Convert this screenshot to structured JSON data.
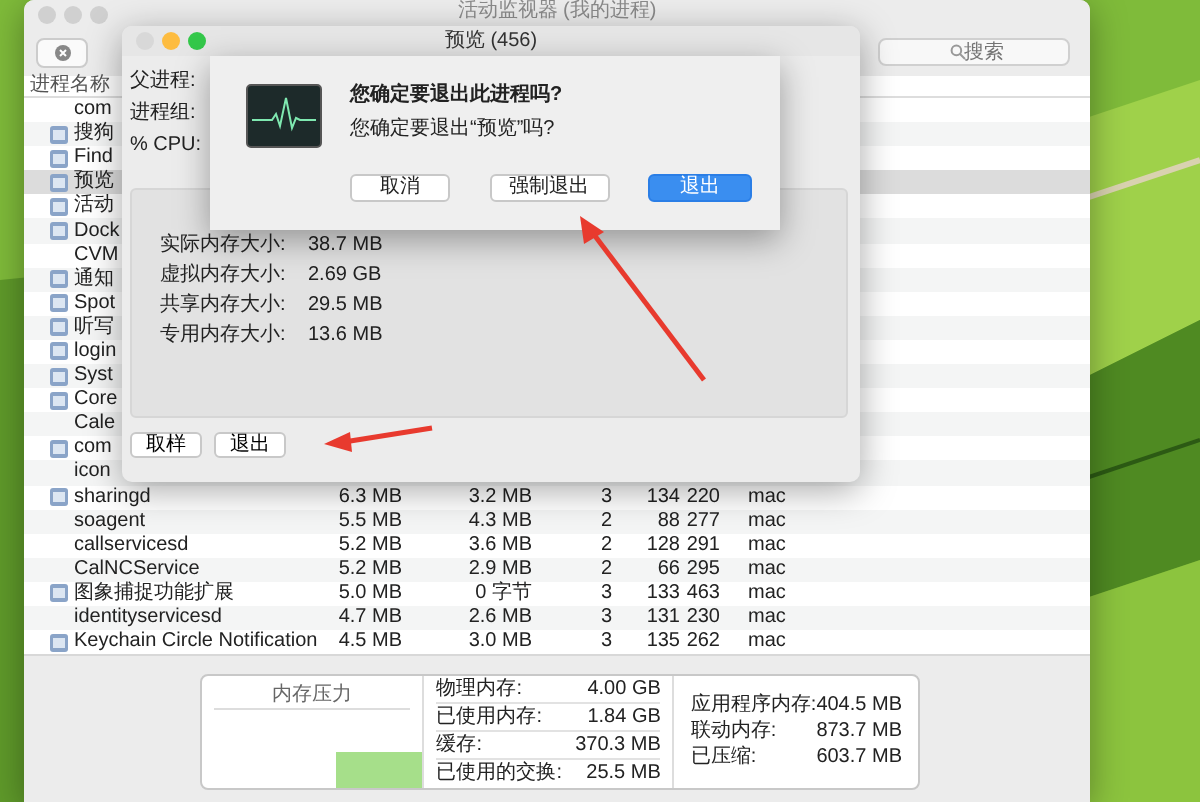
{
  "main_window": {
    "title": "活动监视器 (我的进程)",
    "active": false,
    "search": {
      "placeholder": "搜索"
    },
    "columns": [
      "进程名称"
    ],
    "rows": [
      {
        "cells": [
          "com"
        ],
        "has_icon": false,
        "selected": false
      },
      {
        "cells": [
          "搜狗"
        ],
        "has_icon": true,
        "selected": false
      },
      {
        "cells": [
          "Find"
        ],
        "has_icon": true,
        "selected": false
      },
      {
        "cells": [
          "预览"
        ],
        "has_icon": true,
        "selected": true
      },
      {
        "cells": [
          "活动"
        ],
        "has_icon": true,
        "selected": false
      },
      {
        "cells": [
          "Dock"
        ],
        "has_icon": true,
        "selected": false
      },
      {
        "cells": [
          "CVM"
        ],
        "has_icon": false,
        "selected": false
      },
      {
        "cells": [
          "通知"
        ],
        "has_icon": true,
        "selected": false
      },
      {
        "cells": [
          "Spot"
        ],
        "has_icon": true,
        "selected": false
      },
      {
        "cells": [
          "听写"
        ],
        "has_icon": true,
        "selected": false
      },
      {
        "cells": [
          "login"
        ],
        "has_icon": true,
        "selected": false
      },
      {
        "cells": [
          "Syst"
        ],
        "has_icon": true,
        "selected": false
      },
      {
        "cells": [
          "Core"
        ],
        "has_icon": true,
        "selected": false
      },
      {
        "cells": [
          "Cale"
        ],
        "has_icon": false,
        "selected": false
      },
      {
        "cells": [
          "com"
        ],
        "has_icon": true,
        "selected": false
      },
      {
        "cells": [
          "icon"
        ],
        "has_icon": false,
        "selected": false
      },
      {
        "cells": [
          "sharingd",
          "6.3 MB",
          "3.2 MB",
          "3",
          "134",
          "220",
          "mac"
        ],
        "has_icon": true,
        "selected": false
      },
      {
        "cells": [
          "soagent",
          "5.5 MB",
          "4.3 MB",
          "2",
          "88",
          "277",
          "mac"
        ],
        "has_icon": false,
        "selected": false
      },
      {
        "cells": [
          "callservicesd",
          "5.2 MB",
          "3.6 MB",
          "2",
          "128",
          "291",
          "mac"
        ],
        "has_icon": false,
        "selected": false
      },
      {
        "cells": [
          "CalNCService",
          "5.2 MB",
          "2.9 MB",
          "2",
          "66",
          "295",
          "mac"
        ],
        "has_icon": false,
        "selected": false
      },
      {
        "cells": [
          "图象捕捉功能扩展",
          "5.0 MB",
          "0 字节",
          "3",
          "133",
          "463",
          "mac"
        ],
        "has_icon": true,
        "selected": false
      },
      {
        "cells": [
          "identityservicesd",
          "4.7 MB",
          "2.6 MB",
          "3",
          "131",
          "230",
          "mac"
        ],
        "has_icon": false,
        "selected": false
      },
      {
        "cells": [
          "Keychain Circle Notification",
          "4.5 MB",
          "3.0 MB",
          "3",
          "135",
          "262",
          "mac"
        ],
        "has_icon": true,
        "selected": false
      }
    ],
    "memory_pressure": {
      "label": "内存压力"
    },
    "memory_stats": [
      {
        "label": "物理内存:",
        "value": "4.00 GB"
      },
      {
        "label": "已使用内存:",
        "value": "1.84 GB"
      },
      {
        "label": "缓存:",
        "value": "370.3 MB"
      },
      {
        "label": "已使用的交换:",
        "value": "25.5 MB"
      }
    ],
    "app_memory": [
      {
        "label": "应用程序内存:",
        "value": "404.5 MB"
      },
      {
        "label": "联动内存:",
        "value": "873.7 MB"
      },
      {
        "label": "已压缩:",
        "value": "603.7 MB"
      }
    ]
  },
  "inspector": {
    "title": "预览 (456)",
    "active": true,
    "info": [
      {
        "label": "父进程:"
      },
      {
        "label": "进程组:"
      },
      {
        "label": "% CPU:"
      }
    ],
    "memory": [
      {
        "label": "实际内存大小:",
        "value": "38.7 MB"
      },
      {
        "label": "虚拟内存大小:",
        "value": "2.69 GB"
      },
      {
        "label": "共享内存大小:",
        "value": "29.5 MB"
      },
      {
        "label": "专用内存大小:",
        "value": "13.6 MB"
      }
    ],
    "buttons": [
      "取样",
      "退出"
    ]
  },
  "alert": {
    "title": "您确定要退出此进程吗?",
    "message": "您确定要退出“预览”吗?",
    "buttons": [
      {
        "label": "取消",
        "kind": "plain"
      },
      {
        "label": "强制退出",
        "kind": "plain"
      },
      {
        "label": "退出",
        "kind": "default"
      }
    ]
  }
}
